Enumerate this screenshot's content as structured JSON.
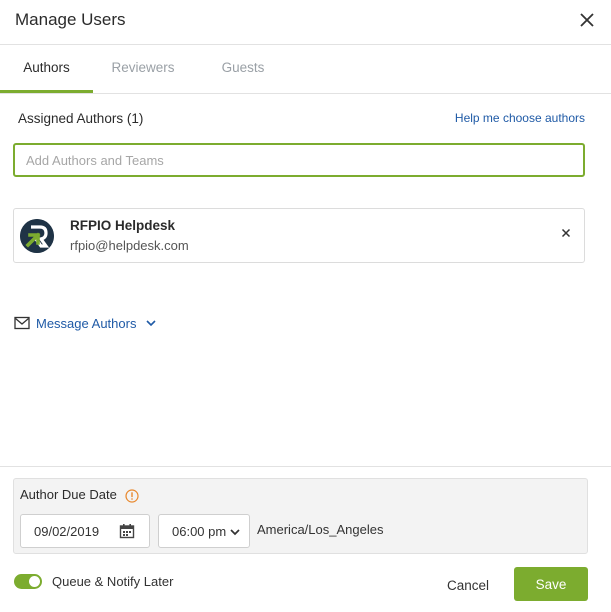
{
  "dialog": {
    "title": "Manage Users"
  },
  "tabs": [
    {
      "label": "Authors",
      "active": true
    },
    {
      "label": "Reviewers",
      "active": false
    },
    {
      "label": "Guests",
      "active": false
    }
  ],
  "assigned": {
    "label": "Assigned Authors (1)",
    "help_link": "Help me choose authors",
    "search_placeholder": "Add Authors and Teams",
    "search_value": ""
  },
  "authors": [
    {
      "name": "RFPIO Helpdesk",
      "email": "rfpio@helpdesk.com",
      "avatar_icon": "rfpio-logo-icon"
    }
  ],
  "message_authors": {
    "label": "Message Authors"
  },
  "due_date": {
    "label": "Author Due Date",
    "date": "09/02/2019",
    "time": "06:00 pm",
    "timezone": "America/Los_Angeles"
  },
  "footer": {
    "toggle_label": "Queue & Notify Later",
    "toggle_on": true,
    "cancel_label": "Cancel",
    "save_label": "Save"
  },
  "colors": {
    "accent": "#7cac2f",
    "link": "#1f5aa6",
    "info": "#e8882d"
  }
}
